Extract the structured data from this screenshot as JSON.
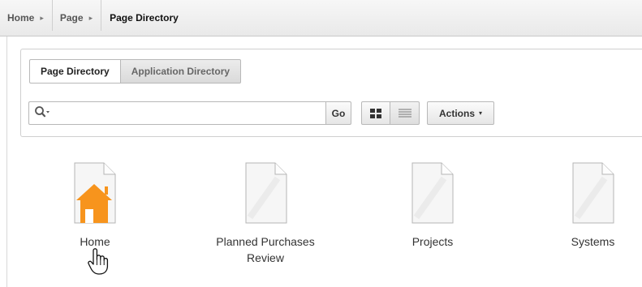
{
  "breadcrumb": {
    "items": [
      {
        "label": "Home",
        "separator": "▸"
      },
      {
        "label": "Page",
        "separator": "▸"
      },
      {
        "label": "Page Directory"
      }
    ]
  },
  "directory_tabs": {
    "items": [
      "Page Directory",
      "Application Directory"
    ],
    "selected": "Page Directory"
  },
  "search": {
    "value": "",
    "placeholder": "",
    "go_label": "Go"
  },
  "view_toggle": {
    "options": [
      "grid-icon",
      "list-icon"
    ],
    "selected": "grid-icon"
  },
  "actions": {
    "label": "Actions",
    "caret": "▾"
  },
  "tiles": [
    {
      "label": "Home",
      "icon": "home-page-icon"
    },
    {
      "label": "Planned Purchases Review",
      "icon": "page-icon"
    },
    {
      "label": "Projects",
      "icon": "page-icon"
    },
    {
      "label": "Systems",
      "icon": "page-icon"
    }
  ],
  "colors": {
    "home_icon": "#f7941d",
    "border": "#b8b8b8",
    "breadcrumb_bg": "#efefef"
  }
}
